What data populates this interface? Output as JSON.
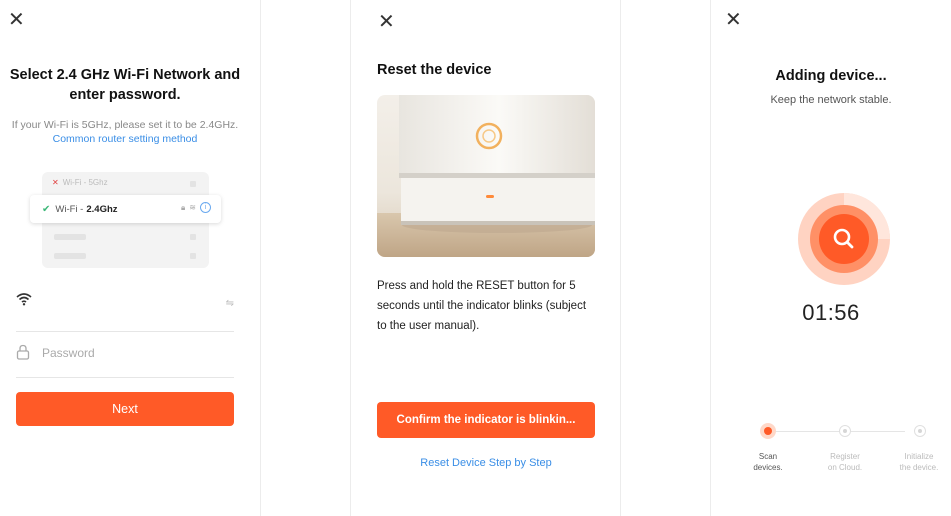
{
  "screen1": {
    "title": "Select 2.4 GHz Wi-Fi Network and enter password.",
    "hint_text": "If your Wi-Fi is 5GHz, please set it to be 2.4GHz.",
    "hint_link": "Common router setting method",
    "illustration": {
      "network_5ghz": "Wi-Fi - 5Ghz",
      "network_24_prefix": "Wi-Fi -",
      "network_24_band": "2.4Ghz"
    },
    "wifi_name_value": "",
    "password_placeholder": "Password",
    "next_label": "Next"
  },
  "screen2": {
    "title": "Reset the device",
    "description": "Press and hold the RESET button for 5 seconds until the indicator blinks (subject to the user manual).",
    "confirm_label": "Confirm the indicator is blinkin...",
    "reset_link": "Reset Device Step by Step"
  },
  "screen3": {
    "title": "Adding device...",
    "subtitle": "Keep the network stable.",
    "timer": "01:56",
    "steps": [
      {
        "label_line1": "Scan",
        "label_line2": "devices.",
        "state": "active"
      },
      {
        "label_line1": "Register",
        "label_line2": "on Cloud.",
        "state": "pending"
      },
      {
        "label_line1": "Initialize",
        "label_line2": "the device.",
        "state": "pending"
      }
    ]
  },
  "icons": {
    "close": "close-icon",
    "wifi": "wifi-icon",
    "lock": "lock-icon",
    "swap": "swap-icon",
    "search": "search-icon",
    "power": "power-icon"
  },
  "colors": {
    "accent": "#ff5a27",
    "link": "#3a8ee6",
    "success": "#3cb878",
    "error": "#e04040"
  }
}
